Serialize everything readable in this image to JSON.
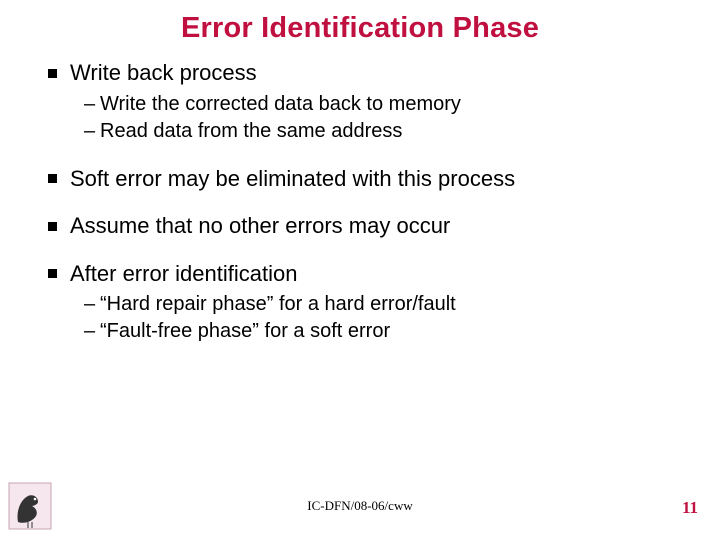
{
  "title": "Error Identification Phase",
  "bullets": {
    "b0": {
      "text": "Write back process",
      "sub": [
        "Write the corrected data back to memory",
        "Read data from the same address"
      ]
    },
    "b1": {
      "text": "Soft error may be eliminated with this process"
    },
    "b2": {
      "text": "Assume that no other errors may occur"
    },
    "b3": {
      "text": "After error identification",
      "sub": [
        "“Hard repair phase” for a hard error/fault",
        "“Fault-free phase” for a soft error"
      ]
    }
  },
  "footer": "IC-DFN/08-06/cww",
  "pageNumber": "11"
}
